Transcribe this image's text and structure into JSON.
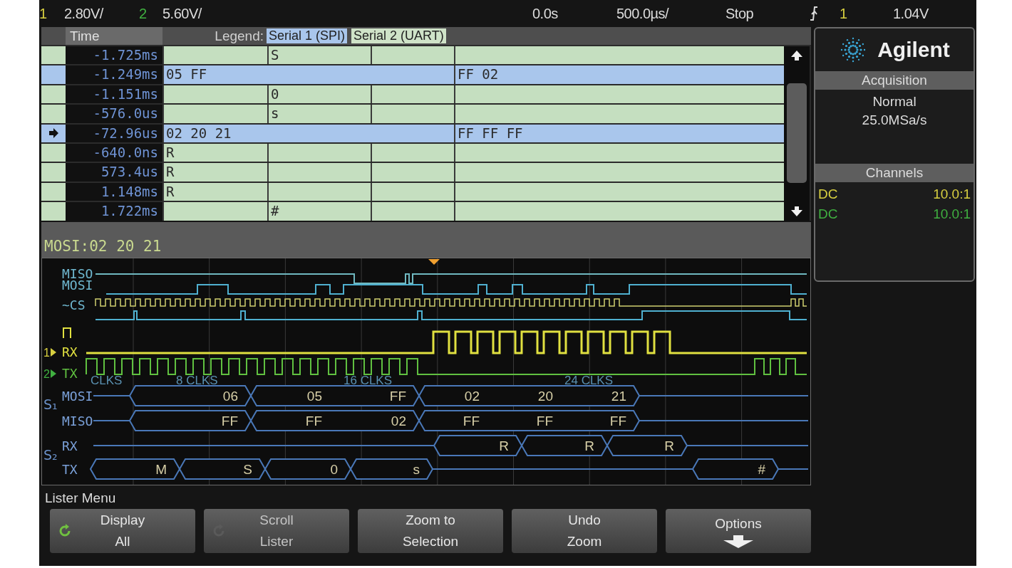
{
  "status_bar": {
    "items": [
      {
        "kind": "channel",
        "text": "1",
        "color": "#d8d040"
      },
      {
        "kind": "value",
        "text": "2.80V/"
      },
      {
        "kind": "channel",
        "text": "2",
        "color": "#40b040"
      },
      {
        "kind": "value",
        "text": "5.60V/"
      },
      {
        "kind": "value",
        "text": "0.0s"
      },
      {
        "kind": "value",
        "text": "500.0µs/"
      },
      {
        "kind": "value",
        "text": "Stop"
      },
      {
        "kind": "trigger"
      },
      {
        "kind": "channel",
        "text": "1",
        "color": "#d8d040"
      },
      {
        "kind": "value",
        "text": "1.04V"
      }
    ]
  },
  "lister": {
    "header": {
      "time": "Time",
      "legend": "Legend:",
      "protocols": [
        {
          "kind": "spi",
          "text": "Serial 1 (SPI)"
        },
        {
          "kind": "uart",
          "text": "Serial 2 (UART)"
        }
      ]
    },
    "rows": [
      {
        "time": "-1.725ms",
        "kind": "uart",
        "current": false,
        "tx": "S"
      },
      {
        "time": "-1.249ms",
        "kind": "spi",
        "current": false,
        "mosi": "05 FF",
        "miso": "FF 02"
      },
      {
        "time": "-1.151ms",
        "kind": "uart",
        "current": false,
        "tx": "0"
      },
      {
        "time": "-576.0us",
        "kind": "uart",
        "current": false,
        "tx": "s"
      },
      {
        "time": "-72.96us",
        "kind": "spi",
        "current": true,
        "mosi": "02 20 21",
        "miso": "FF FF FF"
      },
      {
        "time": "-640.0ns",
        "kind": "uart",
        "current": false,
        "rx": "R"
      },
      {
        "time": "573.4us",
        "kind": "uart",
        "current": false,
        "rx": "R"
      },
      {
        "time": "1.148ms",
        "kind": "uart",
        "current": false,
        "rx": "R"
      },
      {
        "time": "1.722ms",
        "kind": "uart",
        "current": false,
        "tx": "#"
      }
    ]
  },
  "selection_summary": "MOSI:02 20 21",
  "waveform": {
    "channel_markers": [
      {
        "text": "1",
        "color": "#d8d040"
      },
      {
        "text": "2",
        "color": "#40b040"
      }
    ],
    "traces": [
      {
        "kind": "miso",
        "label": "MISO"
      },
      {
        "kind": "mosi",
        "label": "MOSI"
      },
      {
        "kind": "cs",
        "label": "~CS"
      },
      {
        "kind": "rx",
        "label": "RX"
      },
      {
        "kind": "tx",
        "label": "TX"
      }
    ],
    "clock_notes": [
      "CLKS",
      "8 CLKS",
      "16 CLKS",
      "24 CLKS"
    ],
    "bus_groups": [
      {
        "name": "S₁",
        "rows": [
          {
            "label": "MOSI",
            "packets": [
              [
                "06"
              ],
              [
                "05",
                "FF"
              ],
              [
                "02",
                "20",
                "21"
              ]
            ]
          },
          {
            "label": "MISO",
            "packets": [
              [
                "FF"
              ],
              [
                "FF",
                "02"
              ],
              [
                "FF",
                "FF",
                "FF"
              ]
            ]
          }
        ]
      },
      {
        "name": "S₂",
        "rows": [
          {
            "label": "RX",
            "packets": [
              [
                "R"
              ],
              [
                "R"
              ],
              [
                "R"
              ]
            ]
          },
          {
            "label": "TX",
            "packets": [
              [
                "M"
              ],
              [
                "S"
              ],
              [
                "0"
              ],
              [
                "s"
              ],
              [
                "#"
              ]
            ]
          }
        ]
      }
    ]
  },
  "side_panel": {
    "brand": "Agilent",
    "acquisition": {
      "title": "Acquisition",
      "lines": [
        "Normal",
        "25.0MSa/s"
      ]
    },
    "channels": {
      "title": "Channels",
      "rows": [
        {
          "coupling": "DC",
          "probe": "10.0:1",
          "color": "#d8d040"
        },
        {
          "coupling": "DC",
          "probe": "10.0:1",
          "color": "#40b040"
        }
      ]
    }
  },
  "menu": {
    "title": "Lister Menu",
    "softkeys": [
      {
        "lines": [
          "Display",
          "All"
        ],
        "disabled": false
      },
      {
        "lines": [
          "Scroll",
          "Lister"
        ],
        "disabled": true
      },
      {
        "lines": [
          "Zoom to",
          "Selection"
        ],
        "disabled": false
      },
      {
        "lines": [
          "Undo",
          "Zoom"
        ],
        "disabled": false
      },
      {
        "lines": [
          "Options"
        ],
        "disabled": false
      }
    ]
  }
}
